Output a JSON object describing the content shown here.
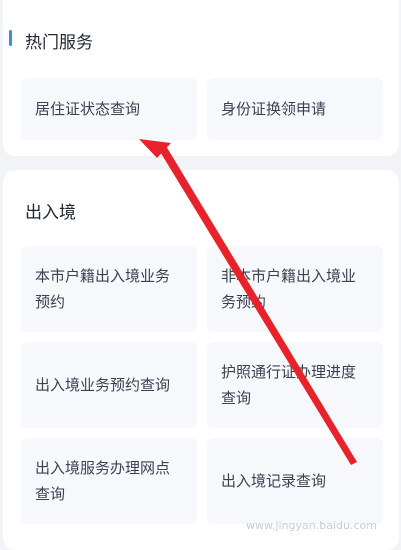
{
  "hot_services": {
    "title": "热门服务",
    "tiles": [
      {
        "label": "居住证状态查询"
      },
      {
        "label": "身份证换领申请"
      }
    ]
  },
  "entry_exit": {
    "title": "出入境",
    "tiles": [
      {
        "label": "本市户籍出入境业务预约"
      },
      {
        "label": "非本市户籍出入境业务预约"
      },
      {
        "label": "出入境业务预约查询"
      },
      {
        "label": "护照通行证办理进度查询"
      },
      {
        "label": "出入境服务办理网点查询"
      },
      {
        "label": "出入境记录查询"
      }
    ]
  },
  "watermark": "www.jingyan.baidu.com",
  "colors": {
    "accent": "#3b8fd9",
    "annotation_arrow": "#e8222a"
  }
}
